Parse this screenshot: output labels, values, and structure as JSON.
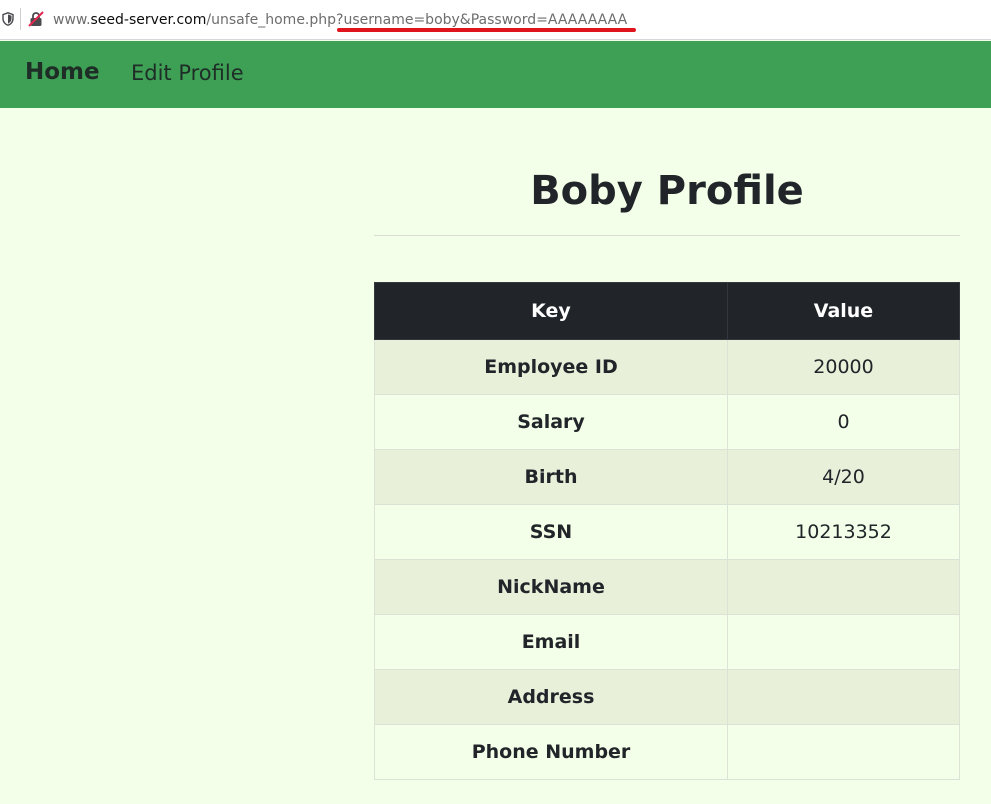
{
  "address_bar": {
    "url_prefix": "www.",
    "url_domain": "seed-server.com",
    "url_path": "/unsafe_home.php",
    "url_query": "?username=boby&Password=AAAAAAAA"
  },
  "navbar": {
    "brand": "Home",
    "links": [
      "Edit Profile"
    ]
  },
  "page": {
    "title": "Boby Profile"
  },
  "profile_table": {
    "headers": [
      "Key",
      "Value"
    ],
    "rows": [
      {
        "key": "Employee ID",
        "value": "20000"
      },
      {
        "key": "Salary",
        "value": "0"
      },
      {
        "key": "Birth",
        "value": "4/20"
      },
      {
        "key": "SSN",
        "value": "10213352"
      },
      {
        "key": "NickName",
        "value": ""
      },
      {
        "key": "Email",
        "value": ""
      },
      {
        "key": "Address",
        "value": ""
      },
      {
        "key": "Phone Number",
        "value": ""
      }
    ]
  },
  "colors": {
    "navbar_bg": "#3ea055",
    "page_bg": "#f4ffe9",
    "table_header_bg": "#212529",
    "stripe_bg": "#e8f0da",
    "highlight_underline": "#e0141d"
  }
}
